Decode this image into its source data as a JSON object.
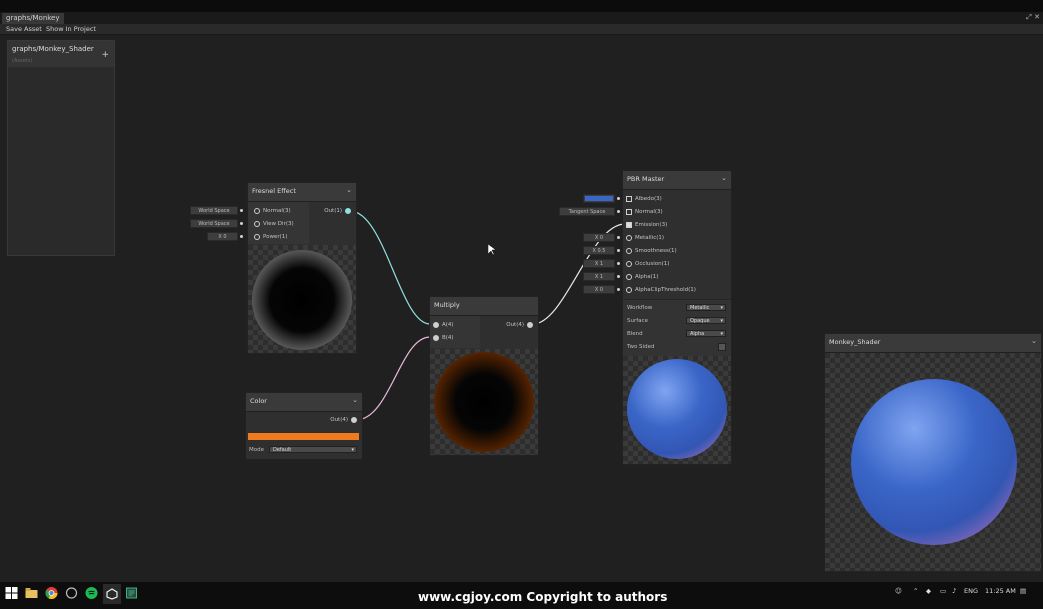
{
  "window": {
    "tab_title": "graphs/Monkey",
    "controls": "⤢ ✕"
  },
  "toolbar": {
    "save_asset": "Save Asset",
    "show_in_project": "Show In Project"
  },
  "blackboard": {
    "title": "graphs/Monkey_Shader",
    "subtitle": "(Assets)",
    "add": "+"
  },
  "fresnel": {
    "title": "Fresnel Effect",
    "inputs": [
      "Normal(3)",
      "View Dir(3)",
      "Power(1)"
    ],
    "output": "Out(1)",
    "chips": [
      "World Space",
      "World Space",
      "X  0"
    ]
  },
  "multiply": {
    "title": "Multiply",
    "inputs": [
      "A(4)",
      "B(4)"
    ],
    "output": "Out(4)"
  },
  "color": {
    "title": "Color",
    "output": "Out(4)",
    "mode_label": "Mode",
    "mode_value": "Default",
    "swatch": "#f07a1e"
  },
  "pbr": {
    "title": "PBR Master",
    "inputs": [
      "Albedo(3)",
      "Normal(3)",
      "Emission(3)",
      "Metallic(1)",
      "Smoothness(1)",
      "Occlusion(1)",
      "Alpha(1)",
      "AlphaClipThreshold(1)"
    ],
    "chips": [
      "",
      "Tangent Space",
      "",
      "X  0",
      "X  0.5",
      "X  1",
      "X  1",
      "X  0"
    ],
    "albedo_color": "#3a66c8",
    "settings": [
      {
        "label": "Workflow",
        "value": "Metallic"
      },
      {
        "label": "Surface",
        "value": "Opaque"
      },
      {
        "label": "Blend",
        "value": "Alpha"
      },
      {
        "label": "Two Sided",
        "value": ""
      }
    ]
  },
  "preview": {
    "title": "Monkey_Shader"
  },
  "taskbar": {
    "lang": "ENG",
    "time": "11:25 AM"
  },
  "watermark": "www.cgjoy.com  Copyright  to  authors"
}
